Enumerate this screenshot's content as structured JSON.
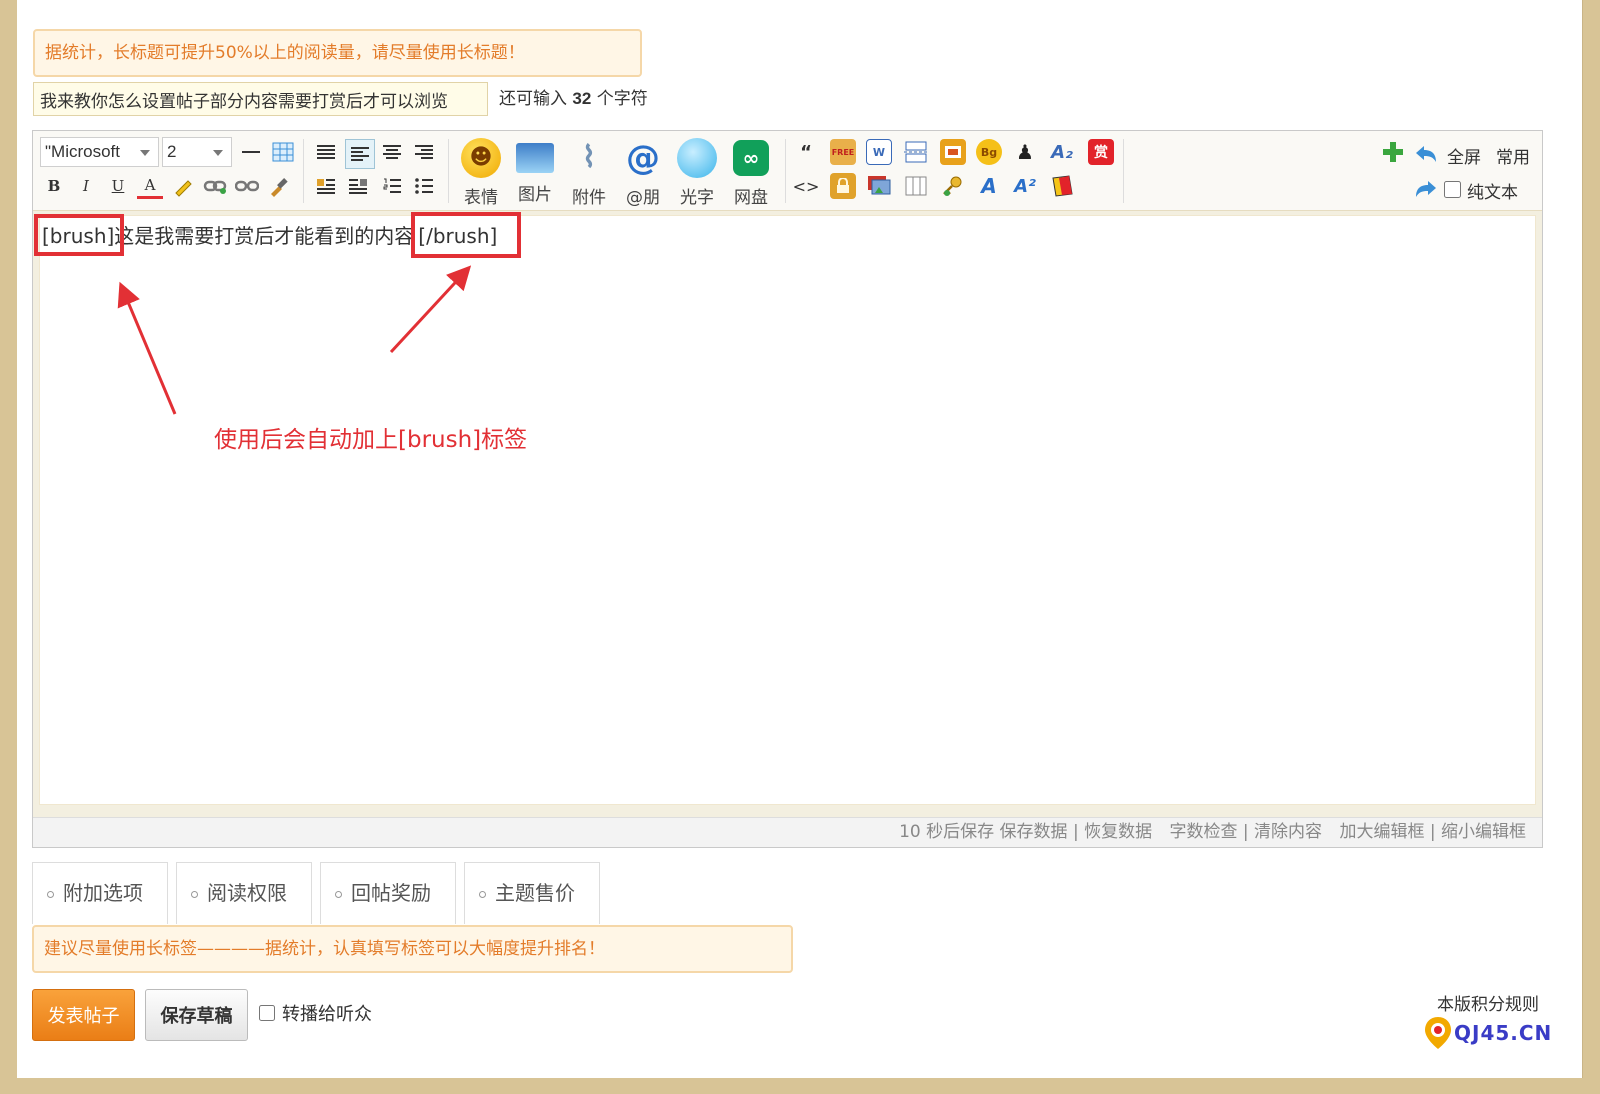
{
  "notice_top": "据统计，长标题可提升50%以上的阅读量，请尽量使用长标题！",
  "title_input": {
    "value": "我来教你怎么设置帖子部分内容需要打赏后才可以浏览"
  },
  "counter": {
    "prefix": "还可输入",
    "count": "32",
    "suffix": "个字符"
  },
  "toolbar": {
    "font_family": "\"Microsoft",
    "font_size": "2",
    "big_buttons": [
      "表情",
      "图片",
      "附件",
      "@朋",
      "光字",
      "网盘"
    ],
    "small_text": {
      "bold": "B",
      "italic": "I",
      "underline": "U",
      "color": "A",
      "quote": "“",
      "code": "<>",
      "reward": "赏",
      "free": "FREE",
      "bg": "Bg",
      "font_a": "A",
      "sub": "A₂",
      "sup": "A²",
      "word": "W"
    },
    "right": {
      "fullscreen": "全屏",
      "common": "常用",
      "plaintext": "纯文本"
    }
  },
  "content": {
    "open_tag": "[brush]",
    "body": "这是我需要打赏后才能看到的内容",
    "close_tag": "[/brush]"
  },
  "status_bar": {
    "autosave": "10 秒后保存",
    "save": "保存数据",
    "restore": "恢复数据",
    "wordcount": "字数检查",
    "clear": "清除内容",
    "enlarge": "加大编辑框",
    "shrink": "缩小编辑框",
    "sep": "|"
  },
  "annotation": {
    "text": "使用后会自动加上[brush]标签"
  },
  "tabs": [
    "附加选项",
    "阅读权限",
    "回帖奖励",
    "主题售价"
  ],
  "notice_bottom": "建议尽量使用长标签————据统计，认真填写标签可以大幅度提升排名！",
  "buttons": {
    "post": "发表帖子",
    "draft": "保存草稿",
    "forward": "转播给听众"
  },
  "footer": {
    "rules": "本版积分规则",
    "logo": "QJ45.CN"
  },
  "colors": {
    "accent_orange": "#f08a1e",
    "annotation_red": "#e23035",
    "notice_bg": "#fff6e6",
    "background": "#d8c496"
  }
}
